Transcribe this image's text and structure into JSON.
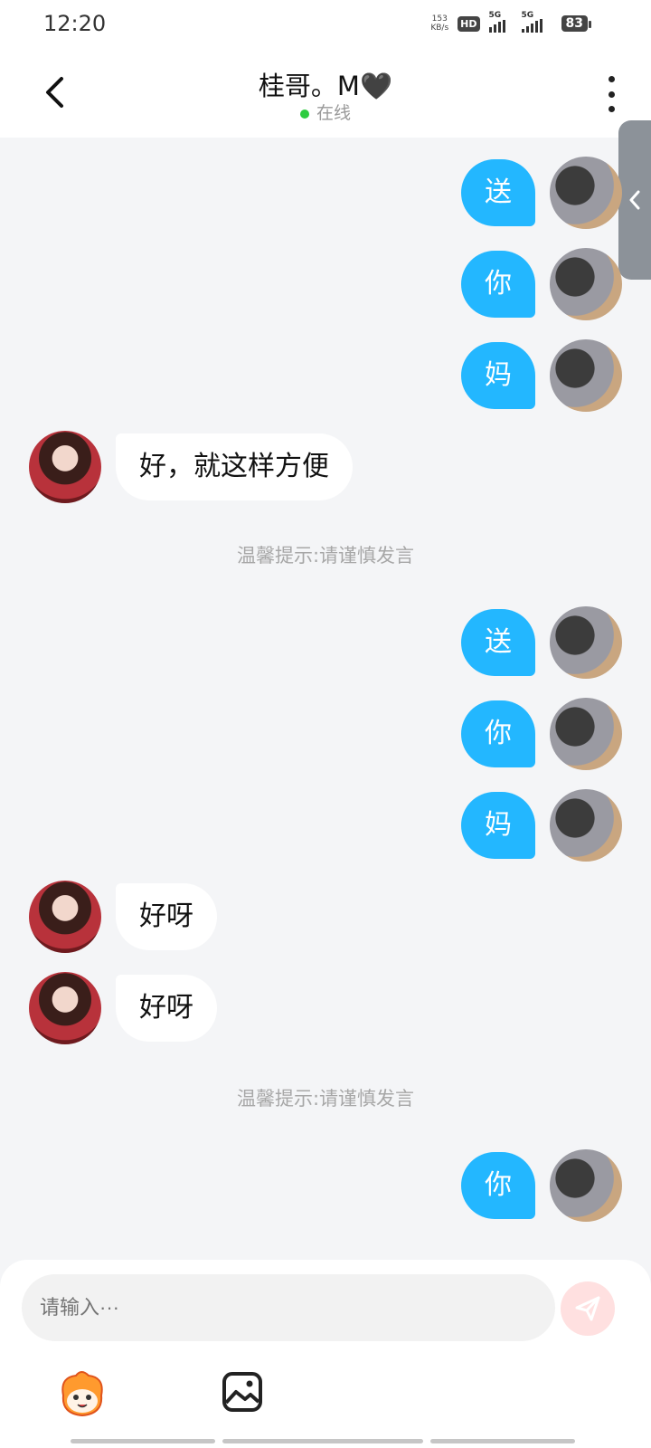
{
  "status_bar": {
    "time": "12:20",
    "net_speed_value": "153",
    "net_speed_unit": "KB/s",
    "hd_label": "HD",
    "signal1_label": "5G",
    "signal2_label": "5G",
    "battery": "83"
  },
  "header": {
    "title": "桂哥。M🖤",
    "presence": "在线",
    "presence_color": "#2ecc40"
  },
  "messages": [
    {
      "side": "sent",
      "text": "送"
    },
    {
      "side": "sent",
      "text": "你"
    },
    {
      "side": "sent",
      "text": "妈"
    },
    {
      "side": "recv",
      "text": "好，就这样方便"
    },
    {
      "side": "notice",
      "text": "温馨提示:请谨慎发言"
    },
    {
      "side": "sent",
      "text": "送"
    },
    {
      "side": "sent",
      "text": "你"
    },
    {
      "side": "sent",
      "text": "妈"
    },
    {
      "side": "recv",
      "text": "好呀"
    },
    {
      "side": "recv",
      "text": "好呀"
    },
    {
      "side": "notice",
      "text": "温馨提示:请谨慎发言"
    },
    {
      "side": "sent",
      "text": "你"
    }
  ],
  "composer": {
    "placeholder": "请输入···",
    "send_icon": "send-icon",
    "emoji_icon": "emoji-sticker-icon",
    "image_icon": "image-icon"
  },
  "colors": {
    "sent_bubble": "#23b7ff",
    "recv_bubble": "#ffffff",
    "background": "#f4f5f7"
  }
}
